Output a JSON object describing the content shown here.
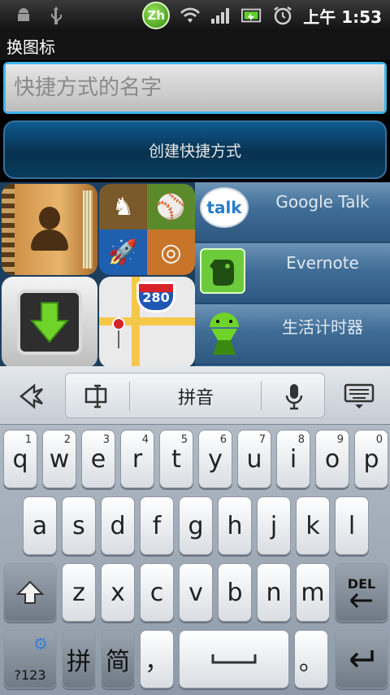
{
  "status_bar": {
    "time_prefix": "上午",
    "time": "1:53",
    "input_method_badge": "Zh",
    "icons": [
      "android-icon",
      "usb-icon",
      "wifi-icon",
      "signal-icon",
      "battery-icon",
      "alarm-icon"
    ]
  },
  "title": "换图标",
  "name_input": {
    "placeholder": "快捷方式的名字",
    "value": ""
  },
  "create_button": "创建快捷方式",
  "icon_grid": {
    "tiles": [
      "contacts-app-icon",
      "games-app-icon",
      "download-app-icon",
      "maps-app-icon"
    ],
    "maps_shield_number": "280"
  },
  "app_list": [
    {
      "label": "Google Talk",
      "icon": "google-talk-icon",
      "icon_text": "talk"
    },
    {
      "label": "Evernote",
      "icon": "evernote-icon"
    },
    {
      "label": "生活计时器",
      "icon": "android-timer-icon"
    }
  ],
  "keyboard": {
    "mode_label": "拼音",
    "rows": [
      [
        {
          "char": "q",
          "sup": "1"
        },
        {
          "char": "w",
          "sup": "2"
        },
        {
          "char": "e",
          "sup": "3"
        },
        {
          "char": "r",
          "sup": "4"
        },
        {
          "char": "t",
          "sup": "5"
        },
        {
          "char": "y",
          "sup": "6"
        },
        {
          "char": "u",
          "sup": "7"
        },
        {
          "char": "i",
          "sup": "8"
        },
        {
          "char": "o",
          "sup": "9"
        },
        {
          "char": "p",
          "sup": "0"
        }
      ],
      [
        {
          "char": "a"
        },
        {
          "char": "s"
        },
        {
          "char": "d"
        },
        {
          "char": "f"
        },
        {
          "char": "g"
        },
        {
          "char": "h"
        },
        {
          "char": "j"
        },
        {
          "char": "k"
        },
        {
          "char": "l"
        }
      ],
      [
        {
          "char": "z"
        },
        {
          "char": "x"
        },
        {
          "char": "c"
        },
        {
          "char": "v"
        },
        {
          "char": "b"
        },
        {
          "char": "n"
        },
        {
          "char": "m"
        }
      ]
    ],
    "del_label": "DEL",
    "symbols_label": "?123",
    "pinyin_key": "拼",
    "simplified_key": "简",
    "comma_key": "，",
    "period_key": "。"
  },
  "colors": {
    "accent_blue": "#3bb6e8",
    "button_dark_blue": "#07324f",
    "list_blue": "#3f6d96",
    "keyboard_grey": "#b8c1cb"
  }
}
